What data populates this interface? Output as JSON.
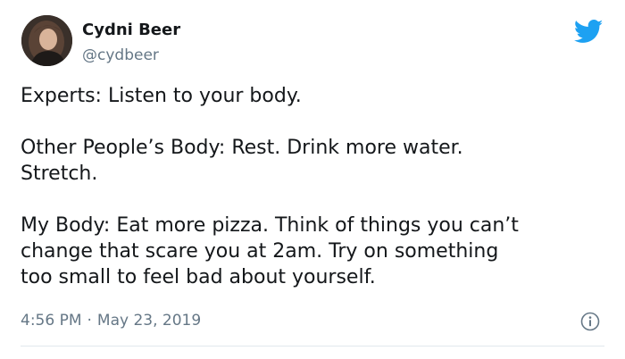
{
  "author": {
    "name": "Cydni Beer",
    "handle": "@cydbeer"
  },
  "tweet": {
    "paragraphs": [
      "Experts: Listen to your body.",
      "Other People’s Body: Rest. Drink more water.\nStretch.",
      "My Body: Eat more pizza. Think of things you can’t\nchange that scare you at 2am. Try on something\ntoo small to feel bad about yourself."
    ],
    "time": "4:56 PM",
    "separator": "·",
    "date": "May 23, 2019"
  },
  "icons": {
    "brand": "twitter-bird-icon",
    "info": "info-icon"
  },
  "colors": {
    "twitter_blue": "#1da1f2",
    "text_primary": "#14171a",
    "text_secondary": "#657786",
    "divider": "#e1e8ed"
  }
}
